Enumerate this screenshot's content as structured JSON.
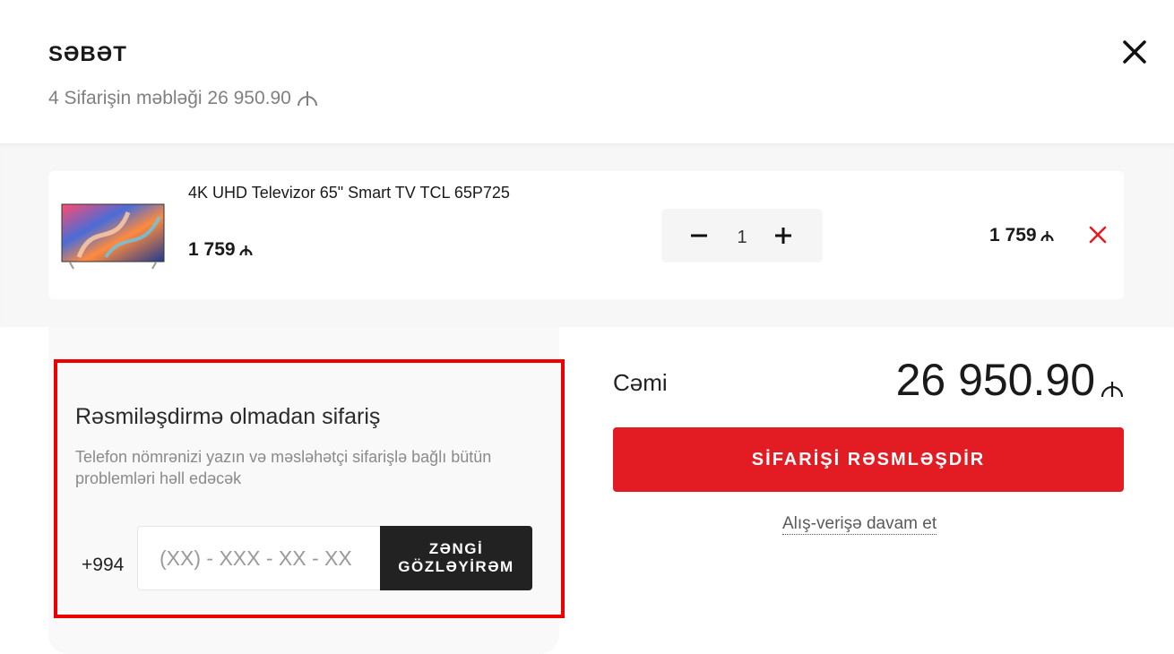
{
  "header": {
    "title": "SƏBƏT",
    "subtitle": "4 Sifarişin məbləği 26 950.90",
    "close_icon": "close-icon"
  },
  "cart": {
    "items": [
      {
        "name": "4K UHD Televizor 65\" Smart TV TCL 65P725",
        "price": "1 759",
        "quantity": "1",
        "total": "1 759",
        "image": "tv-image"
      }
    ]
  },
  "quick_order": {
    "title": "Rəsmiləşdirmə olmadan sifariş",
    "description": "Telefon nömrənizi yazın və məsləhətçi sifarişlə bağlı bütün problemləri həll edəcək",
    "phone_prefix": "+994",
    "phone_placeholder": "(XX) - XXX - XX - XX",
    "call_button_line1": "ZƏNGİ",
    "call_button_line2": "GÖZLƏYİRƏM"
  },
  "summary": {
    "total_label": "Cəmi",
    "total_amount": "26 950.90",
    "checkout_label": "SİFARİŞİ RƏSMLƏŞDİR",
    "continue_label": "Alış-verişə davam et"
  },
  "colors": {
    "accent": "#e31c23",
    "highlight_border": "#ee0000",
    "dark_button": "#222222"
  },
  "icons": {
    "currency": "manat-icon",
    "remove": "remove-icon",
    "minus": "minus-icon",
    "plus": "plus-icon"
  }
}
